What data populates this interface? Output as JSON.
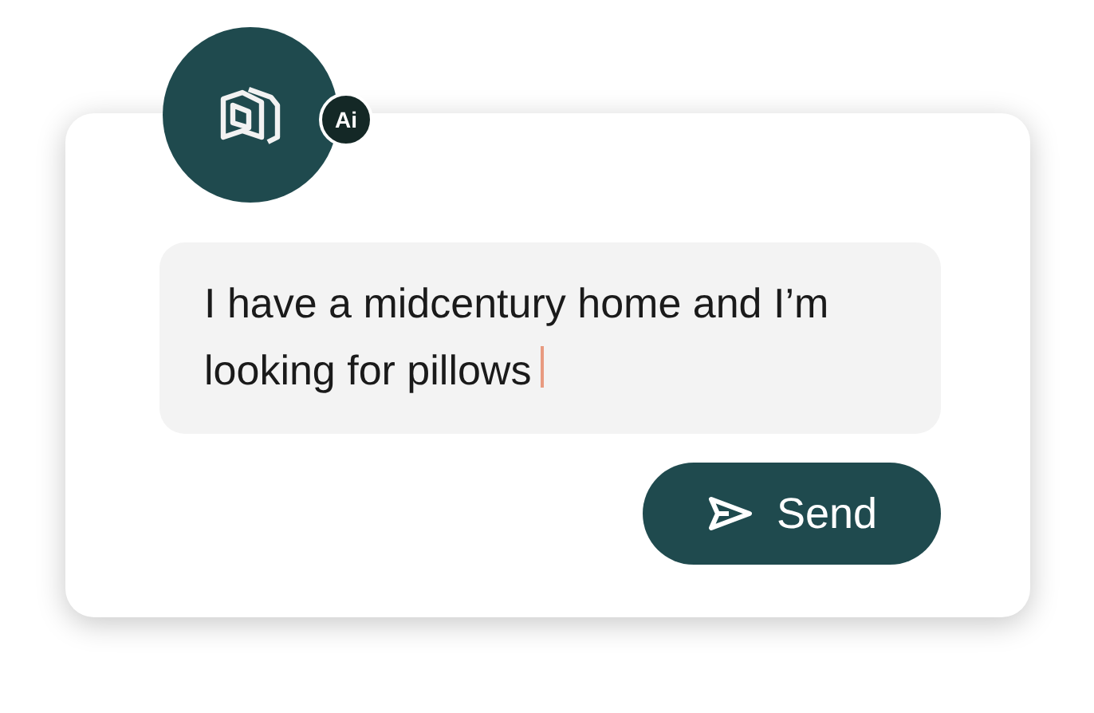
{
  "assistant": {
    "badge": "Ai"
  },
  "message": {
    "text": "I have a midcentury home and I’m looking for pillows",
    "cursor": true
  },
  "send_button": {
    "label": "Send"
  }
}
